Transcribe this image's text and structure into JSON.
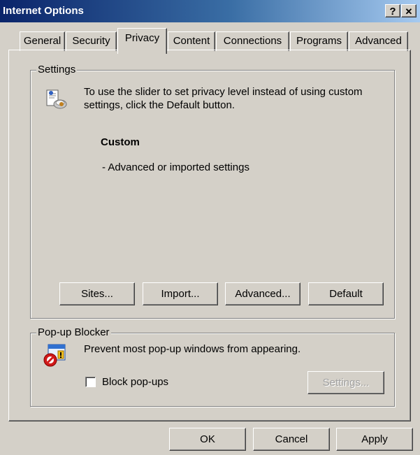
{
  "window": {
    "title": "Internet Options",
    "help_button": "?",
    "close_button": "✕"
  },
  "tabs": [
    {
      "label": "General"
    },
    {
      "label": "Security"
    },
    {
      "label": "Privacy",
      "active": true
    },
    {
      "label": "Content"
    },
    {
      "label": "Connections"
    },
    {
      "label": "Programs"
    },
    {
      "label": "Advanced"
    }
  ],
  "settings": {
    "group_label": "Settings",
    "description_line1": "To use the slider to set privacy level instead of using custom",
    "description_line2": "settings, click the Default button.",
    "level_title": "Custom",
    "level_desc": "- Advanced or imported settings",
    "buttons": {
      "sites": "Sites...",
      "import": "Import...",
      "advanced": "Advanced...",
      "default": "Default"
    }
  },
  "popup_blocker": {
    "group_label": "Pop-up Blocker",
    "description": "Prevent most pop-up windows from appearing.",
    "checkbox_label": "Block pop-ups",
    "checkbox_checked": false,
    "settings_button": "Settings..."
  },
  "footer": {
    "ok": "OK",
    "cancel": "Cancel",
    "apply": "Apply"
  },
  "colors": {
    "titlebar_start": "#0a246a",
    "titlebar_end": "#a6caf0",
    "face": "#d4d0c8"
  },
  "icons": [
    "privacy-icon",
    "popup-blocker-icon",
    "help-icon",
    "close-icon"
  ]
}
